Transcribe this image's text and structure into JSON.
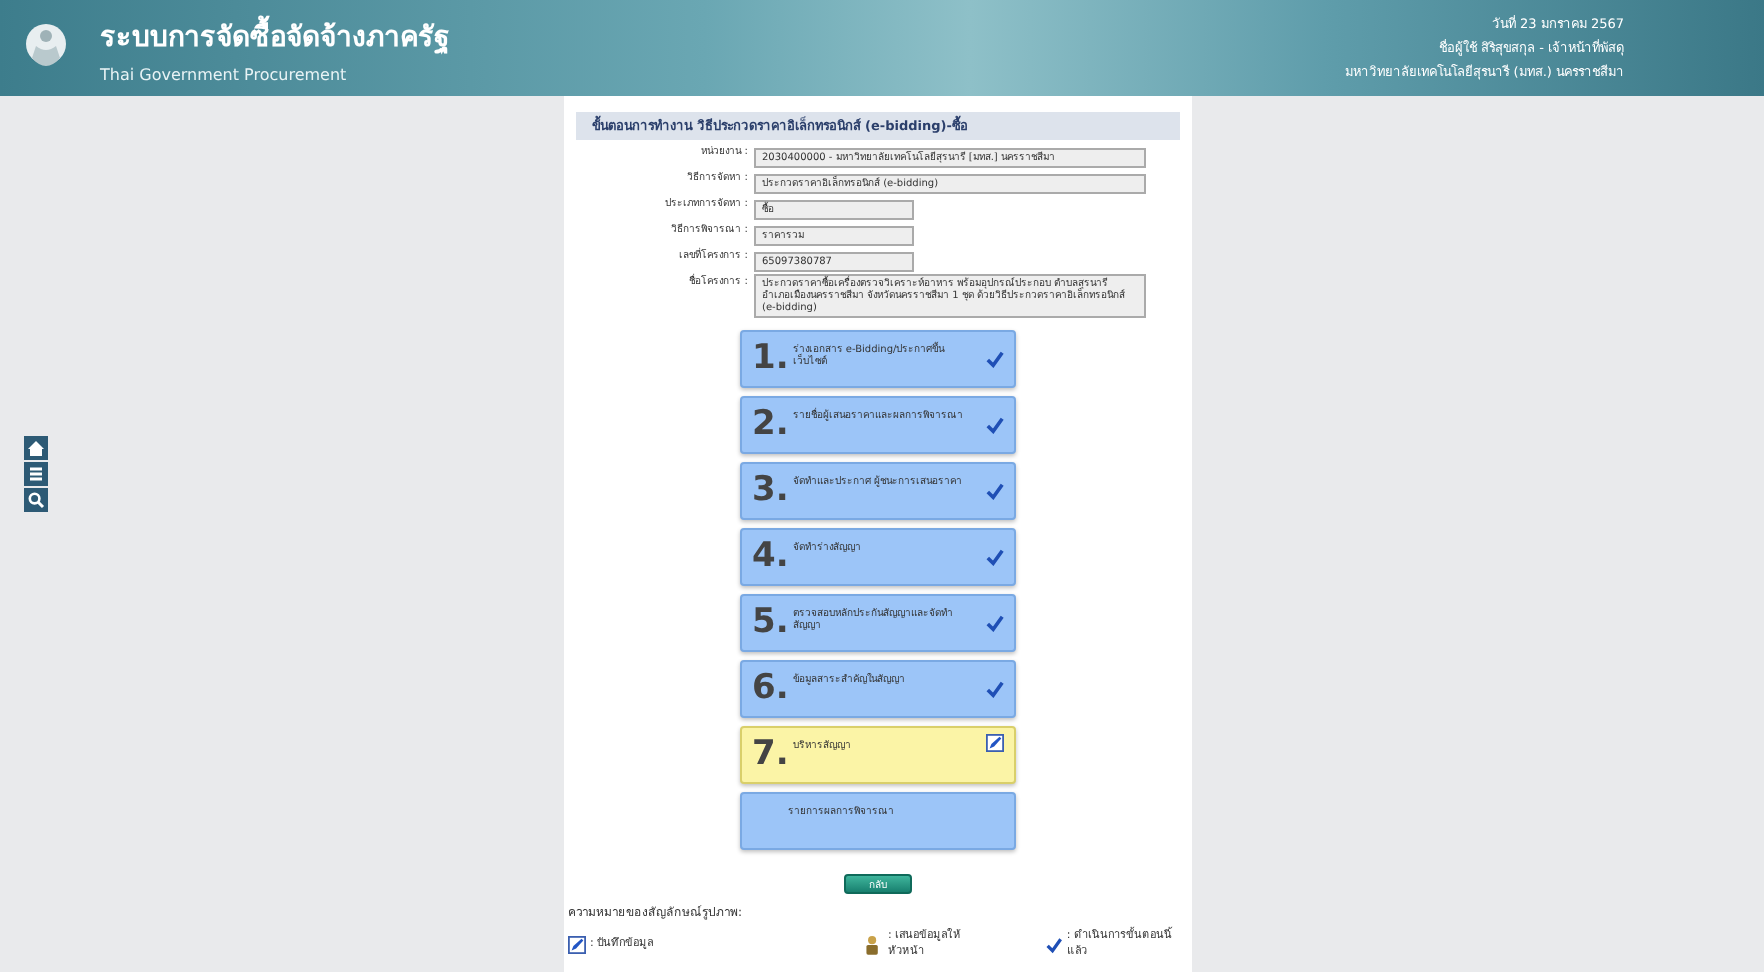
{
  "header": {
    "title": "ระบบการจัดซื้อจัดจ้างภาครัฐ",
    "subtitle": "Thai Government Procurement",
    "user_lines": [
      "วันที่ 23 มกราคม 2567",
      "ชื่อผู้ใช้ สิริสุขสกุล - เจ้าหน้าที่พัสดุ",
      "มหาวิทยาลัยเทคโนโลยีสุรนารี (มทส.) นครราชสีมา"
    ]
  },
  "side_toolbar": [
    {
      "kind": "home"
    },
    {
      "kind": "menu"
    },
    {
      "kind": "search"
    }
  ],
  "panel": {
    "title": "ขั้นตอนการทำงาน วิธีประกวดราคาอิเล็กทรอนิกส์ (e-bidding)-ซื้อ",
    "fields": [
      {
        "label": "หน่วยงาน :",
        "value": "2030400000 - มหาวิทยาลัยเทคโนโลยีสุรนารี [มทส.] นครราชสีมา",
        "kind": "wide"
      },
      {
        "label": "วิธีการจัดหา :",
        "value": "ประกวดราคาอิเล็กทรอนิกส์ (e-bidding)",
        "kind": "wide"
      },
      {
        "label": "ประเภทการจัดหา :",
        "value": "ซื้อ",
        "kind": "short"
      },
      {
        "label": "วิธีการพิจารณา :",
        "value": "ราคารวม",
        "kind": "short"
      },
      {
        "label": "เลขที่โครงการ :",
        "value": "65097380787",
        "kind": "short"
      },
      {
        "label": "ชื่อโครงการ :",
        "value": "ประกวดราคาซื้อเครื่องตรวจวิเคราะห์อาหาร พร้อมอุปกรณ์ประกอบ ตำบลสุรนารี อำเภอเมืองนครราชสีมา จังหวัดนครราชสีมา 1 ชุด ด้วยวิธีประกวดราคาอิเล็กทรอนิกส์ (e-bidding)",
        "kind": "wide"
      }
    ],
    "steps": [
      {
        "number": "1.",
        "label": "ร่างเอกสาร e-Bidding/ประกาศขึ้นเว็บไซต์",
        "kind": "done",
        "selected": false
      },
      {
        "number": "2.",
        "label": "รายชื่อผู้เสนอราคาและผลการพิจารณา",
        "kind": "done",
        "selected": false
      },
      {
        "number": "3.",
        "label": "จัดทำและประกาศ ผู้ชนะการเสนอราคา",
        "kind": "done",
        "selected": false
      },
      {
        "number": "4.",
        "label": "จัดทำร่างสัญญา",
        "kind": "done",
        "selected": false
      },
      {
        "number": "5.",
        "label": "ตรวจสอบหลักประกันสัญญาและจัดทำสัญญา",
        "kind": "done",
        "selected": false
      },
      {
        "number": "6.",
        "label": "ข้อมูลสาระสำคัญในสัญญา",
        "kind": "done",
        "selected": false
      },
      {
        "number": "7.",
        "label": "บริหารสัญญา",
        "kind": "edit",
        "selected": true
      },
      {
        "label": "รายการผลการพิจารณา",
        "kind": "none",
        "selected": false
      }
    ],
    "back_button": "กลับ",
    "legend": {
      "title": "ความหมายของสัญลักษณ์รูปภาพ:",
      "items": [
        {
          "kind": "edit",
          "label": ": บันทึกข้อมูล"
        },
        {
          "kind": "person",
          "label": ": เสนอข้อมูลให้หัวหน้า"
        },
        {
          "kind": "done",
          "label": ": ดำเนินการขั้นตอนนี้แล้ว"
        }
      ]
    }
  }
}
